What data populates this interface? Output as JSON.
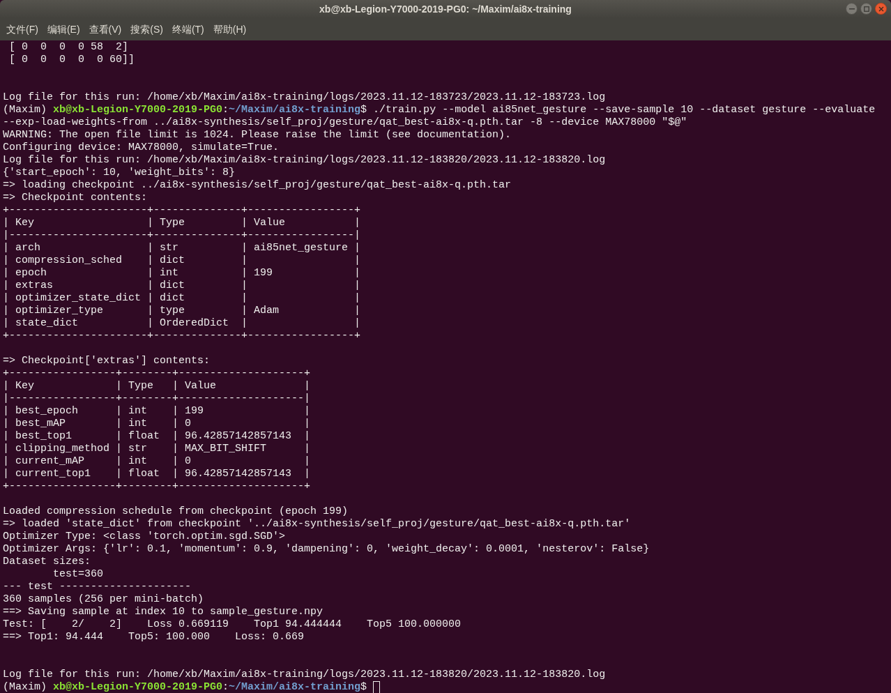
{
  "window": {
    "title": "xb@xb-Legion-Y7000-2019-PG0: ~/Maxim/ai8x-training"
  },
  "menu": [
    "文件(F)",
    "编辑(E)",
    "查看(V)",
    "搜索(S)",
    "终端(T)",
    "帮助(H)"
  ],
  "terminal": {
    "lines": [
      {
        "kind": "text",
        "text": " [ 0  0  0  0 58  2]"
      },
      {
        "kind": "text",
        "text": " [ 0  0  0  0  0 60]]"
      },
      {
        "kind": "blank"
      },
      {
        "kind": "blank"
      },
      {
        "kind": "text",
        "text": "Log file for this run: /home/xb/Maxim/ai8x-training/logs/2023.11.12-183723/2023.11.12-183723.log"
      },
      {
        "kind": "prompt",
        "segments": [
          {
            "kind": "plain",
            "text": "(Maxim) "
          },
          {
            "kind": "user",
            "text": "xb@xb-Legion-Y7000-2019-PG0"
          },
          {
            "kind": "plain",
            "text": ":"
          },
          {
            "kind": "path",
            "text": "~/Maxim/ai8x-training"
          },
          {
            "kind": "plain",
            "text": "$ ./train.py --model ai85net_gesture --save-sample 10 --dataset gesture --evaluate"
          }
        ]
      },
      {
        "kind": "text",
        "text": "--exp-load-weights-from ../ai8x-synthesis/self_proj/gesture/qat_best-ai8x-q.pth.tar -8 --device MAX78000 \"$@\""
      },
      {
        "kind": "text",
        "text": "WARNING: The open file limit is 1024. Please raise the limit (see documentation)."
      },
      {
        "kind": "text",
        "text": "Configuring device: MAX78000, simulate=True."
      },
      {
        "kind": "text",
        "text": "Log file for this run: /home/xb/Maxim/ai8x-training/logs/2023.11.12-183820/2023.11.12-183820.log"
      },
      {
        "kind": "text",
        "text": "{'start_epoch': 10, 'weight_bits': 8}"
      },
      {
        "kind": "text",
        "text": "=> loading checkpoint ../ai8x-synthesis/self_proj/gesture/qat_best-ai8x-q.pth.tar"
      },
      {
        "kind": "text",
        "text": "=> Checkpoint contents:"
      },
      {
        "kind": "text",
        "text": "+----------------------+--------------+-----------------+"
      },
      {
        "kind": "text",
        "text": "| Key                  | Type         | Value           |"
      },
      {
        "kind": "text",
        "text": "|----------------------+--------------+-----------------|"
      },
      {
        "kind": "text",
        "text": "| arch                 | str          | ai85net_gesture |"
      },
      {
        "kind": "text",
        "text": "| compression_sched    | dict         |                 |"
      },
      {
        "kind": "text",
        "text": "| epoch                | int          | 199             |"
      },
      {
        "kind": "text",
        "text": "| extras               | dict         |                 |"
      },
      {
        "kind": "text",
        "text": "| optimizer_state_dict | dict         |                 |"
      },
      {
        "kind": "text",
        "text": "| optimizer_type       | type         | Adam            |"
      },
      {
        "kind": "text",
        "text": "| state_dict           | OrderedDict  |                 |"
      },
      {
        "kind": "text",
        "text": "+----------------------+--------------+-----------------+"
      },
      {
        "kind": "blank"
      },
      {
        "kind": "text",
        "text": "=> Checkpoint['extras'] contents:"
      },
      {
        "kind": "text",
        "text": "+-----------------+--------+--------------------+"
      },
      {
        "kind": "text",
        "text": "| Key             | Type   | Value              |"
      },
      {
        "kind": "text",
        "text": "|-----------------+--------+--------------------|"
      },
      {
        "kind": "text",
        "text": "| best_epoch      | int    | 199                |"
      },
      {
        "kind": "text",
        "text": "| best_mAP        | int    | 0                  |"
      },
      {
        "kind": "text",
        "text": "| best_top1       | float  | 96.42857142857143  |"
      },
      {
        "kind": "text",
        "text": "| clipping_method | str    | MAX_BIT_SHIFT      |"
      },
      {
        "kind": "text",
        "text": "| current_mAP     | int    | 0                  |"
      },
      {
        "kind": "text",
        "text": "| current_top1    | float  | 96.42857142857143  |"
      },
      {
        "kind": "text",
        "text": "+-----------------+--------+--------------------+"
      },
      {
        "kind": "blank"
      },
      {
        "kind": "text",
        "text": "Loaded compression schedule from checkpoint (epoch 199)"
      },
      {
        "kind": "text",
        "text": "=> loaded 'state_dict' from checkpoint '../ai8x-synthesis/self_proj/gesture/qat_best-ai8x-q.pth.tar'"
      },
      {
        "kind": "text",
        "text": "Optimizer Type: <class 'torch.optim.sgd.SGD'>"
      },
      {
        "kind": "text",
        "text": "Optimizer Args: {'lr': 0.1, 'momentum': 0.9, 'dampening': 0, 'weight_decay': 0.0001, 'nesterov': False}"
      },
      {
        "kind": "text",
        "text": "Dataset sizes:"
      },
      {
        "kind": "text",
        "text": "        test=360"
      },
      {
        "kind": "text",
        "text": "--- test ---------------------"
      },
      {
        "kind": "text",
        "text": "360 samples (256 per mini-batch)"
      },
      {
        "kind": "text",
        "text": "==> Saving sample at index 10 to sample_gesture.npy"
      },
      {
        "kind": "text",
        "text": "Test: [    2/    2]    Loss 0.669119    Top1 94.444444    Top5 100.000000"
      },
      {
        "kind": "text",
        "text": "==> Top1: 94.444    Top5: 100.000    Loss: 0.669"
      },
      {
        "kind": "blank"
      },
      {
        "kind": "blank"
      },
      {
        "kind": "text",
        "text": "Log file for this run: /home/xb/Maxim/ai8x-training/logs/2023.11.12-183820/2023.11.12-183820.log"
      },
      {
        "kind": "prompt",
        "cursor": true,
        "segments": [
          {
            "kind": "plain",
            "text": "(Maxim) "
          },
          {
            "kind": "user",
            "text": "xb@xb-Legion-Y7000-2019-PG0"
          },
          {
            "kind": "plain",
            "text": ":"
          },
          {
            "kind": "path",
            "text": "~/Maxim/ai8x-training"
          },
          {
            "kind": "plain",
            "text": "$ "
          }
        ]
      }
    ]
  }
}
